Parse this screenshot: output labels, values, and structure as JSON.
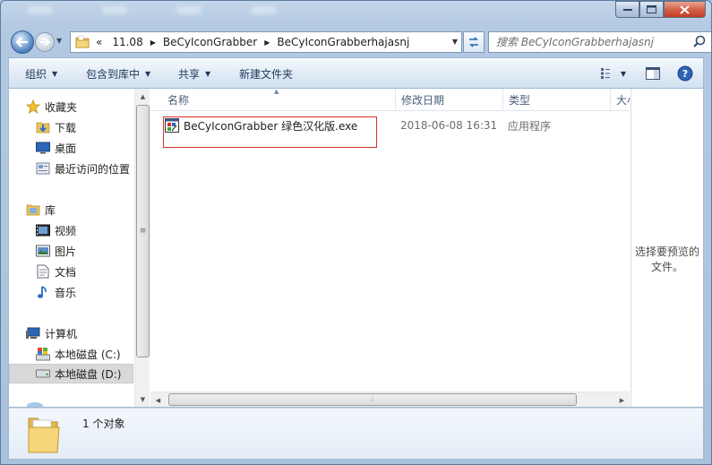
{
  "window": {
    "caption_buttons": [
      "minimize",
      "maximize",
      "close"
    ]
  },
  "address_bar": {
    "history_chevron": "«",
    "crumbs": [
      "11.08",
      "BeCyIconGrabber",
      "BeCyIconGrabberhajasnj"
    ]
  },
  "search": {
    "placeholder": "搜索 BeCyIconGrabberhajasnj"
  },
  "toolbar": {
    "organize": "组织",
    "include_in_library": "包含到库中",
    "share": "共享",
    "new_folder": "新建文件夹"
  },
  "nav": {
    "favorites": "收藏夹",
    "downloads": "下载",
    "desktop": "桌面",
    "recent": "最近访问的位置",
    "libraries": "库",
    "videos": "视频",
    "pictures": "图片",
    "documents": "文档",
    "music": "音乐",
    "computer": "计算机",
    "drive_c": "本地磁盘 (C:)",
    "drive_d": "本地磁盘 (D:)"
  },
  "columns": {
    "name": "名称",
    "date": "修改日期",
    "type": "类型",
    "size": "大小"
  },
  "files": [
    {
      "name": "BeCyIconGrabber 绿色汉化版.exe",
      "date": "2018-06-08 16:31",
      "type": "应用程序"
    }
  ],
  "preview": {
    "text": "选择要预览的文件。"
  },
  "details": {
    "count": "1 个对象"
  },
  "icons": {
    "back": "back-arrow-icon",
    "forward": "forward-arrow-icon",
    "refresh": "refresh-icon",
    "search": "search-icon",
    "view": "view-options-icon",
    "preview_pane": "preview-pane-icon",
    "help": "help-icon"
  }
}
